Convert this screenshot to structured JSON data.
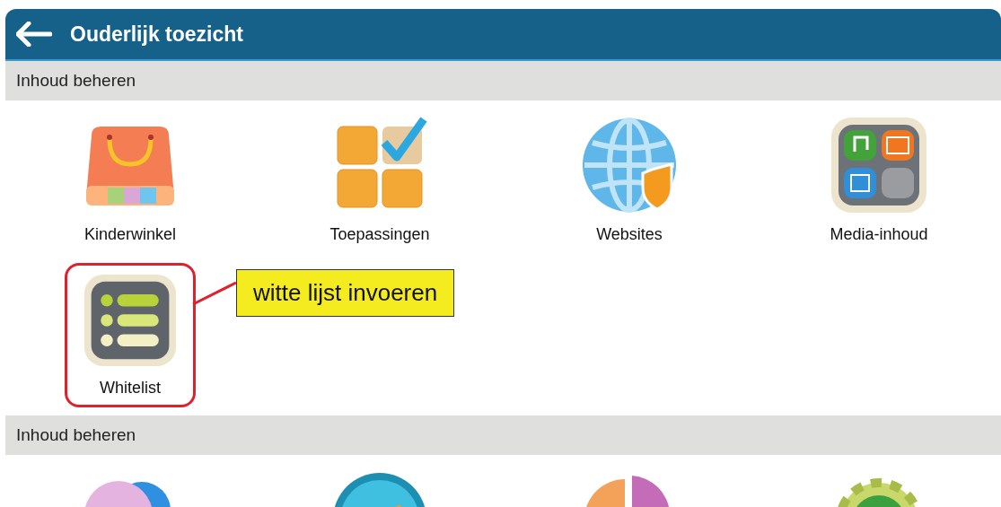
{
  "header": {
    "title": "Ouderlijk toezicht"
  },
  "sections": [
    {
      "title": "Inhoud beheren",
      "items": [
        {
          "label": "Kinderwinkel",
          "highlighted": false
        },
        {
          "label": "Toepassingen",
          "highlighted": false
        },
        {
          "label": "Websites",
          "highlighted": false
        },
        {
          "label": "Media-inhoud",
          "highlighted": false
        },
        {
          "label": "Whitelist",
          "highlighted": true
        }
      ]
    },
    {
      "title": "Inhoud beheren",
      "items": [
        {
          "highlighted": false
        },
        {
          "highlighted": false
        },
        {
          "highlighted": false
        },
        {
          "highlighted": false
        }
      ]
    }
  ],
  "callout": {
    "text": "witte lijst invoeren"
  }
}
